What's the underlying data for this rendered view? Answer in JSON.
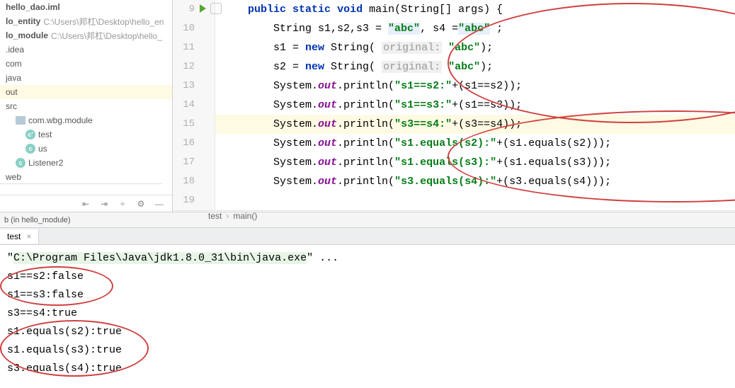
{
  "sidebar": {
    "items": [
      {
        "label": "hello_dao.iml",
        "path": "",
        "bold": true,
        "indent": 0,
        "icon": ""
      },
      {
        "label": "lo_entity",
        "path": "C:\\Users\\邦杠\\Desktop\\hello_en",
        "bold": true,
        "indent": 0,
        "icon": ""
      },
      {
        "label": "lo_module",
        "path": "C:\\Users\\邦杠\\Desktop\\hello_",
        "bold": true,
        "indent": 0,
        "icon": ""
      },
      {
        "label": ".idea",
        "path": "",
        "bold": false,
        "indent": 0,
        "icon": ""
      },
      {
        "label": "com",
        "path": "",
        "bold": false,
        "indent": 0,
        "icon": ""
      },
      {
        "label": "java",
        "path": "",
        "bold": false,
        "indent": 0,
        "icon": ""
      },
      {
        "label": "out",
        "path": "",
        "bold": false,
        "indent": 0,
        "icon": "",
        "selected": true
      },
      {
        "label": "src",
        "path": "",
        "bold": false,
        "indent": 0,
        "icon": ""
      },
      {
        "label": "com.wbg.module",
        "path": "",
        "bold": false,
        "indent": 1,
        "icon": "folder"
      },
      {
        "label": "test",
        "path": "",
        "bold": false,
        "indent": 2,
        "icon": "class"
      },
      {
        "label": "us",
        "path": "",
        "bold": false,
        "indent": 2,
        "icon": "class"
      },
      {
        "label": "Listener2",
        "path": "",
        "bold": false,
        "indent": 1,
        "icon": "class"
      },
      {
        "label": "web",
        "path": "",
        "bold": false,
        "indent": 0,
        "icon": ""
      }
    ]
  },
  "gutter": {
    "lines": [
      9,
      10,
      11,
      12,
      13,
      14,
      15,
      16,
      17,
      18,
      19
    ]
  },
  "code": {
    "l9": {
      "pre": "    ",
      "kw1": "public",
      "sp1": " ",
      "kw2": "static",
      "sp2": " ",
      "kw3": "void",
      "rest": " main(String[] args) {"
    },
    "l10": {
      "pre": "        String s1,s2,s3 = ",
      "s1": "\"abc\"",
      "mid": ", s4 =",
      "s2": "\"abc\"",
      "post": " ;"
    },
    "l11": {
      "pre": "        s1 = ",
      "kw": "new",
      "sp": " String( ",
      "hint": "original:",
      "sp2": " ",
      "s": "\"abc\"",
      "post": ");"
    },
    "l12": {
      "pre": "        s2 = ",
      "kw": "new",
      "sp": " String( ",
      "hint": "original:",
      "sp2": " ",
      "s": "\"abc\"",
      "post": ");"
    },
    "l13": {
      "pre": "        System.",
      "out": "out",
      "mid": ".println(",
      "s": "\"s1==s2:\"",
      "post": "+(s1==s2));"
    },
    "l14": {
      "pre": "        System.",
      "out": "out",
      "mid": ".println(",
      "s": "\"s1==s3:\"",
      "post": "+(s1==s3));"
    },
    "l15": {
      "pre": "        System.",
      "out": "out",
      "mid": ".println(",
      "s": "\"s3==s4:\"",
      "post": "+(s3==s4));"
    },
    "l16": {
      "pre": "        System.",
      "out": "out",
      "mid": ".println(",
      "s": "\"s1.equals(s2):\"",
      "post": "+(s1.equals(s2)));"
    },
    "l17": {
      "pre": "        System.",
      "out": "out",
      "mid": ".println(",
      "s": "\"s1.equals(s3):\"",
      "post": "+(s1.equals(s3)));"
    },
    "l18": {
      "pre": "        System.",
      "out": "out",
      "mid": ".println(",
      "s": "\"s3.equals(s4):\"",
      "post": "+(s3.equals(s4)));"
    }
  },
  "breadcrumb": {
    "a": "test",
    "b": "main()"
  },
  "debug": {
    "header": "b (in hello_module)",
    "tab": "test"
  },
  "console": {
    "cmd_a": "\"",
    "cmd_b": "C:\\Program Files\\Java\\jdk1.8.0_31\\bin\\java.exe",
    "cmd_c": "\" ...",
    "l1": "s1==s2:false",
    "l2": "s1==s3:false",
    "l3": "s3==s4:true",
    "l4": "s1.equals(s2):true",
    "l5": "s1.equals(s3):true",
    "l6": "s3.equals(s4):true"
  }
}
